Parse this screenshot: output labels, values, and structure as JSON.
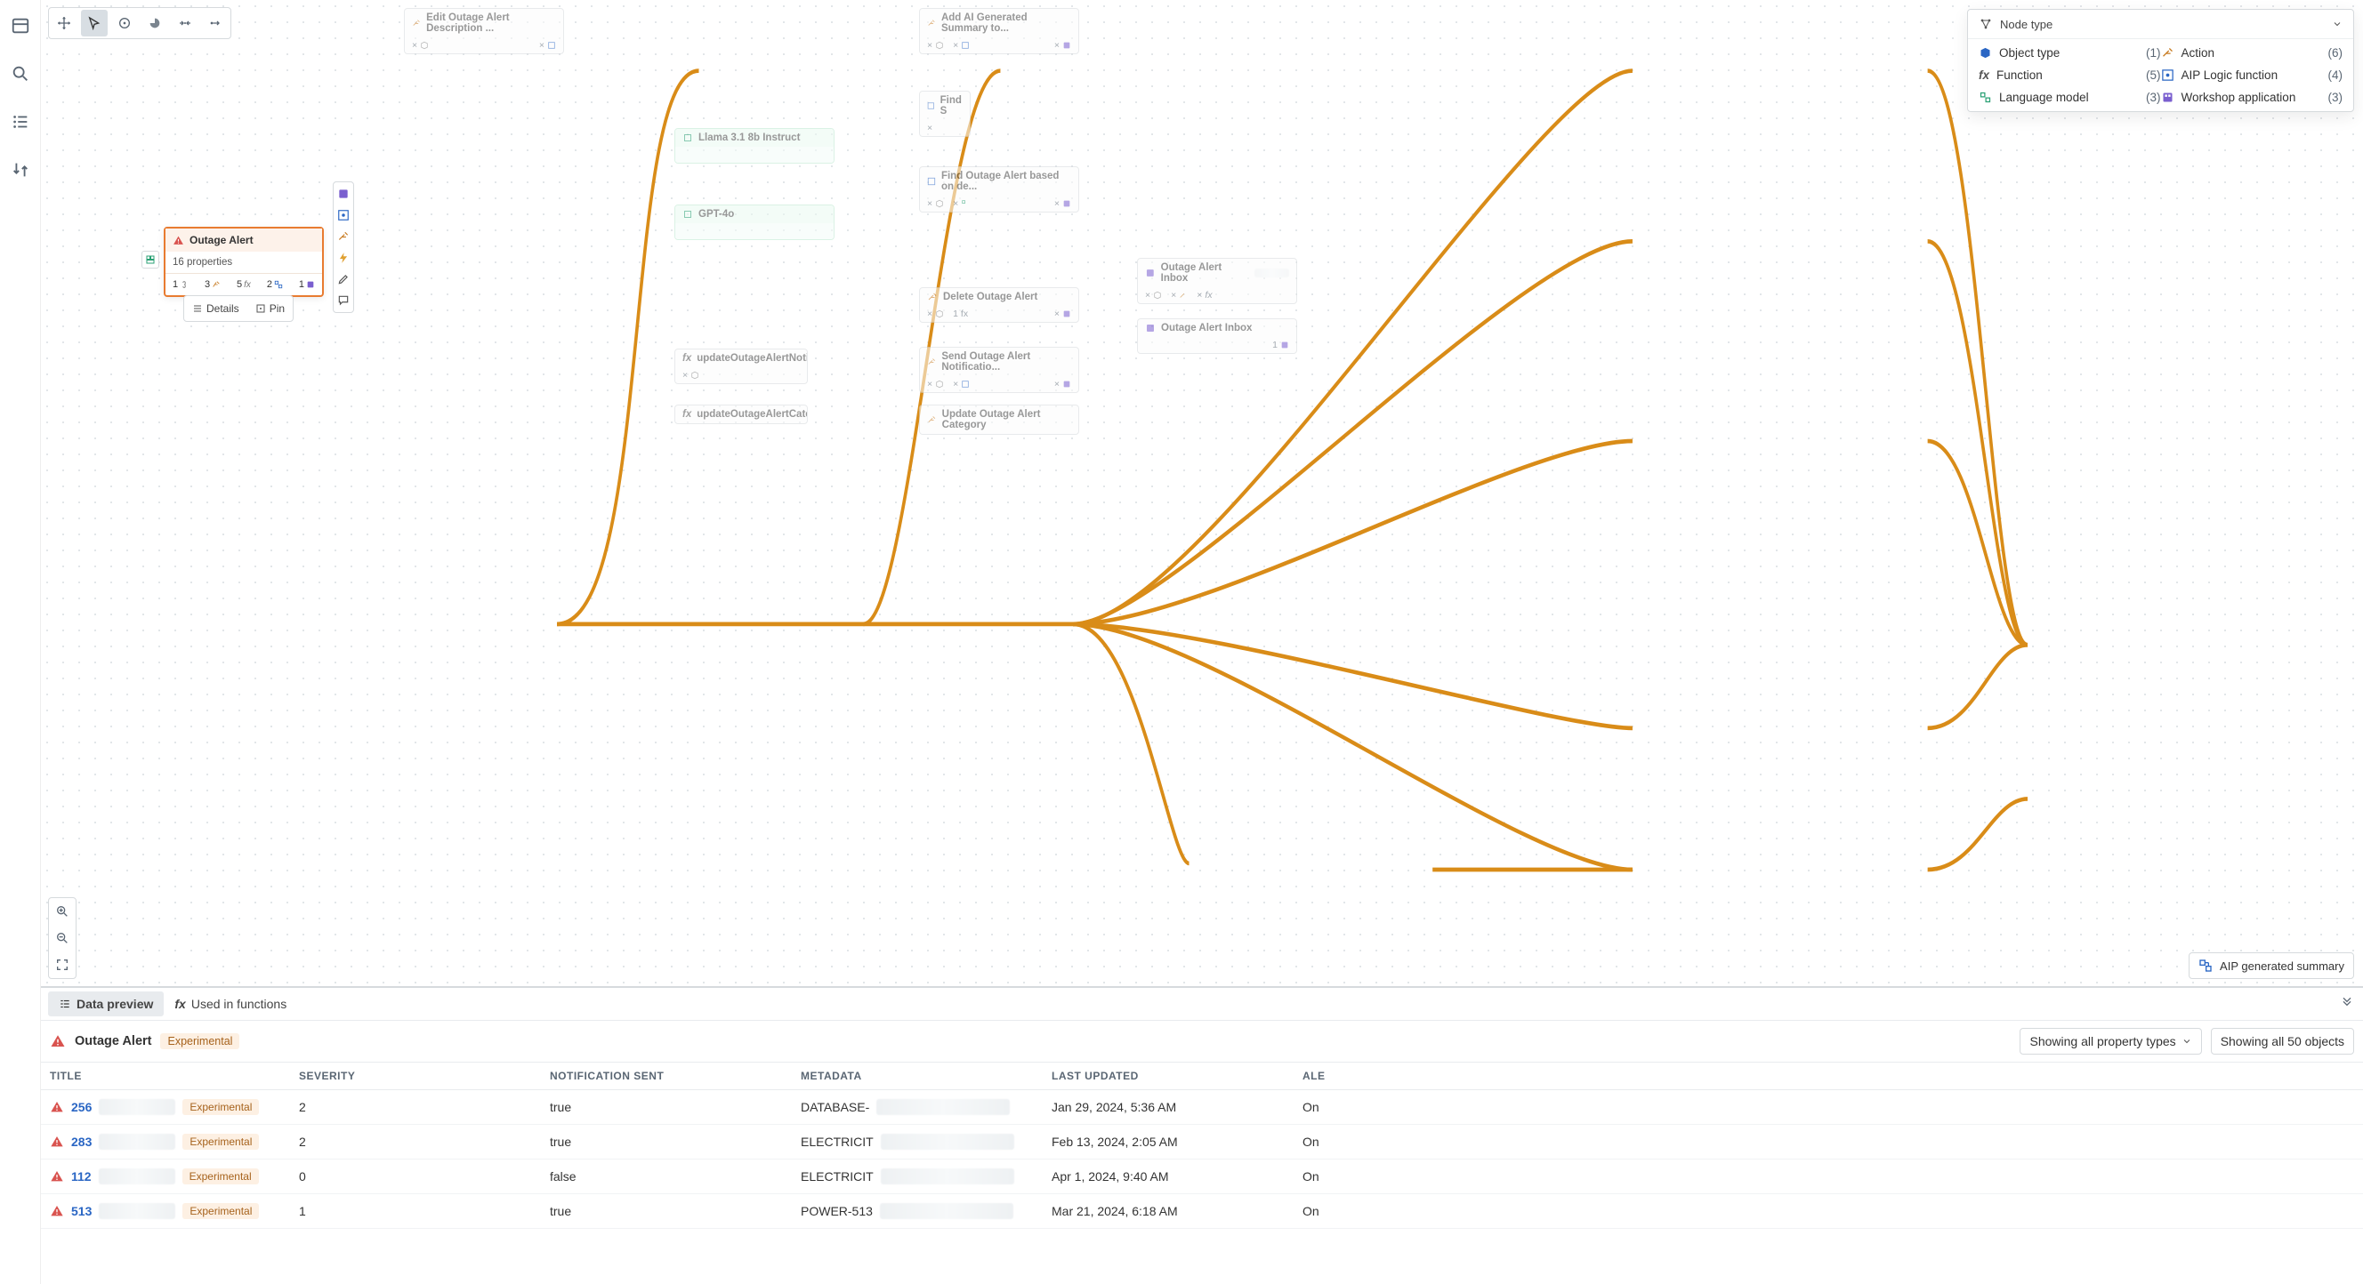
{
  "filter": {
    "selector_label": "Node type",
    "categories": [
      [
        {
          "icon": "cube",
          "color": "#2a66c4",
          "label": "Object type",
          "count": "(1)"
        },
        {
          "icon": "fx",
          "color": "#5a6673",
          "label": "Function",
          "count": "(5)"
        },
        {
          "icon": "chip",
          "color": "#2aa074",
          "label": "Language model",
          "count": "(3)"
        }
      ],
      [
        {
          "icon": "wand",
          "color": "#c77a20",
          "label": "Action",
          "count": "(6)"
        },
        {
          "icon": "aip",
          "color": "#2a66c4",
          "label": "AIP Logic function",
          "count": "(4)"
        },
        {
          "icon": "app",
          "color": "#7a5fcf",
          "label": "Workshop application",
          "count": "(3)"
        }
      ]
    ]
  },
  "aip_pill": "AIP generated summary",
  "focus_node": {
    "title": "Outage Alert",
    "props": "16 properties",
    "stats": [
      "1",
      "3",
      "5",
      "2",
      "1"
    ]
  },
  "focus_actions": {
    "details": "Details",
    "pin": "Pin"
  },
  "nodes": {
    "edit_desc": "Edit Outage Alert Description ...",
    "add_ai_sum": "Add AI Generated Summary to...",
    "find1": "Find S",
    "llama": "Llama 3.1 8b Instruct",
    "find2": "Find Outage Alert based on de...",
    "gpt4o": "GPT-4o",
    "delete": "Delete Outage Alert",
    "send_notif": "Send Outage Alert Notificatio...",
    "update_cat": "Update Outage Alert Category",
    "fx_notif": "updateOutageAlertNotificatio...",
    "fx_cat": "updateOutageAlertCategory",
    "inbox1": "Outage Alert Inbox",
    "inbox2": "Outage Alert Inbox",
    "delete_sub": "1 fx",
    "inbox2_sub": "1"
  },
  "tabs": {
    "preview": "Data preview",
    "used": "Used in functions"
  },
  "summary": {
    "title": "Outage Alert",
    "tag": "Experimental",
    "prop_filter": "Showing all property types",
    "obj_filter": "Showing all 50 objects"
  },
  "columns": {
    "title": "TITLE",
    "severity": "SEVERITY",
    "notif": "NOTIFICATION SENT",
    "meta": "METADATA",
    "updated": "LAST UPDATED",
    "alert": "ALE"
  },
  "rows": [
    {
      "id": "256",
      "tag": "Experimental",
      "severity": "2",
      "notif": "true",
      "meta": "DATABASE-",
      "updated": "Jan 29, 2024, 5:36 AM",
      "alert": "On"
    },
    {
      "id": "283",
      "tag": "Experimental",
      "severity": "2",
      "notif": "true",
      "meta": "ELECTRICIT",
      "updated": "Feb 13, 2024, 2:05 AM",
      "alert": "On"
    },
    {
      "id": "112",
      "tag": "Experimental",
      "severity": "0",
      "notif": "false",
      "meta": "ELECTRICIT",
      "updated": "Apr 1, 2024, 9:40 AM",
      "alert": "On"
    },
    {
      "id": "513",
      "tag": "Experimental",
      "severity": "1",
      "notif": "true",
      "meta": "POWER-513",
      "updated": "Mar 21, 2024, 6:18 AM",
      "alert": "On"
    }
  ]
}
